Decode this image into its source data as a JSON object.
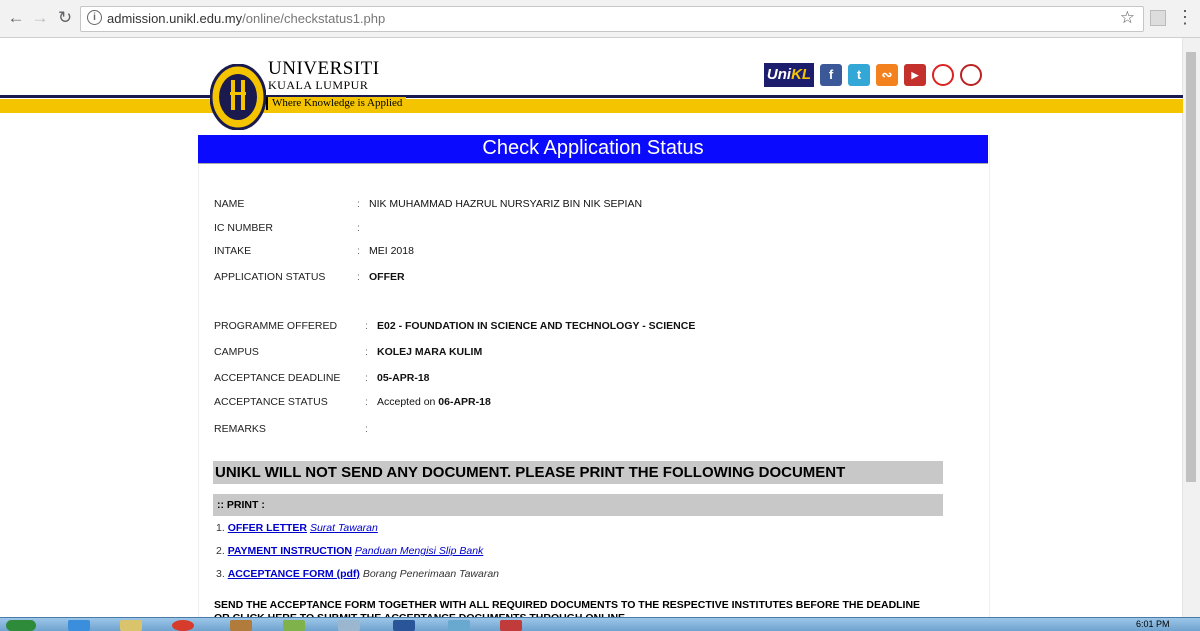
{
  "browser": {
    "back_icon": "back-arrow-icon",
    "forward_icon": "forward-arrow-icon",
    "reload_icon": "reload-icon",
    "url_host": "admission.unikl.edu.my",
    "url_path": "/online/checkstatus1.php",
    "bookmark_icon": "star-icon"
  },
  "header": {
    "brand_line1": "UNIVERSITI",
    "brand_line2": "KUALA LUMPUR",
    "tagline": "Where Knowledge is Applied",
    "unikl_logo_a": "Uni",
    "unikl_logo_b": "KL",
    "social_icons": [
      "facebook-icon",
      "twitter-icon",
      "rss-icon",
      "youtube-icon",
      "partner-logo-icon",
      "seal-icon"
    ],
    "colors": {
      "navy": "#1a1a4e",
      "gold": "#f5c400",
      "title_blue": "#0a0aff"
    }
  },
  "main": {
    "title": "Check Application Status",
    "fields": [
      {
        "label": "NAME",
        "value": "NIK MUHAMMAD HAZRUL NURSYARIZ BIN NIK SEPIAN"
      },
      {
        "label": "IC NUMBER",
        "value": ""
      },
      {
        "label": "INTAKE",
        "value": "MEI 2018"
      },
      {
        "label": "APPLICATION STATUS",
        "value": "OFFER"
      },
      {
        "label": "PROGRAMME OFFERED",
        "value": "E02 - FOUNDATION IN SCIENCE AND TECHNOLOGY - SCIENCE"
      },
      {
        "label": "CAMPUS",
        "value": "KOLEJ MARA KULIM"
      },
      {
        "label": "ACCEPTANCE DEADLINE",
        "value": "05-APR-18"
      },
      {
        "label": "ACCEPTANCE STATUS",
        "value_prefix": "Accepted on ",
        "value": "06-APR-18"
      },
      {
        "label": "REMARKS",
        "value": ""
      }
    ],
    "colon": ":",
    "notice": "UNIKL WILL NOT SEND ANY DOCUMENT. PLEASE PRINT THE FOLLOWING DOCUMENT",
    "print_header": ":: PRINT :",
    "documents": [
      {
        "num": "1.",
        "link": "OFFER LETTER",
        "desc": "Surat Tawaran"
      },
      {
        "num": "2.",
        "link": "PAYMENT INSTRUCTION",
        "desc": "Panduan Mengisi Slip Bank"
      },
      {
        "num": "3.",
        "link": "ACCEPTANCE FORM (pdf)",
        "desc": "Borang Penerimaan Tawaran"
      }
    ],
    "instruction": "SEND THE ACCEPTANCE FORM TOGETHER WITH ALL REQUIRED DOCUMENTS TO THE RESPECTIVE INSTITUTES BEFORE THE DEADLINE",
    "instruction2": "OR CLICK HERE TO SUBMIT THE ACCEPTANCE DOCUMENTS THROUGH ONLINE"
  },
  "taskbar": {
    "clock": "6:01 PM"
  }
}
